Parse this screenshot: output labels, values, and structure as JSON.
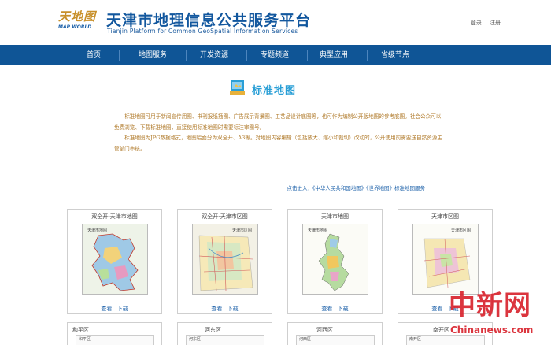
{
  "header": {
    "logo_cn": "天地图",
    "logo_en": "MAP WORLD",
    "title": "天津市地理信息公共服务平台",
    "subtitle": "Tianjin Platform for Common GeoSpatial Information Services",
    "login": "登录",
    "register": "注册"
  },
  "nav": {
    "items": [
      "首页",
      "地图服务",
      "开发资源",
      "专题频道",
      "典型应用",
      "省级节点"
    ]
  },
  "section": {
    "title": "标准地图"
  },
  "intro": {
    "p1": "标准地图可用于新闻宣传用图、书刊报纸插图、广告展示背景图、工艺品设计底图等，也可作为编制公开版地图的参考底图。社会公众可以免费浏览、下载标准地图，直接使用标准地图时需要标注审图号。",
    "p2": "标准地图为JPG数据格式，地图幅面分为双全开、A3等。对地图内容编辑（包括放大、缩小和裁切）改动的，公开使用前需要送自然资源主管部门审核。"
  },
  "special_link": "点击进入：《中华人民共和国地图》《世界地图》标准地图服务",
  "cards": [
    {
      "title": "双全开-天津市地图",
      "view": "查看",
      "download": "下载",
      "map_label": "天津市地图"
    },
    {
      "title": "双全开-天津市区图",
      "view": "查看",
      "download": "下载",
      "map_label": "天津市区图"
    },
    {
      "title": "天津市地图",
      "view": "查看",
      "download": "下载",
      "map_label": "天津市地图"
    },
    {
      "title": "天津市区图",
      "view": "查看",
      "download": "下载",
      "map_label": "天津市区图"
    }
  ],
  "cards_row2": [
    {
      "title": "和平区",
      "map_label": "和平区"
    },
    {
      "title": "河东区",
      "map_label": "河东区"
    },
    {
      "title": "河西区",
      "map_label": "河西区"
    },
    {
      "title": "南开区",
      "map_label": "南开区"
    }
  ],
  "watermark": {
    "cn": "中新网",
    "en": "Chinanews.com"
  },
  "colors": {
    "nav_bg": "#0f5596",
    "title_blue": "#12579e",
    "section_title": "#2a9fd6",
    "intro_text": "#b07a2a",
    "link": "#1a5fa8",
    "watermark": "#d8202a"
  }
}
